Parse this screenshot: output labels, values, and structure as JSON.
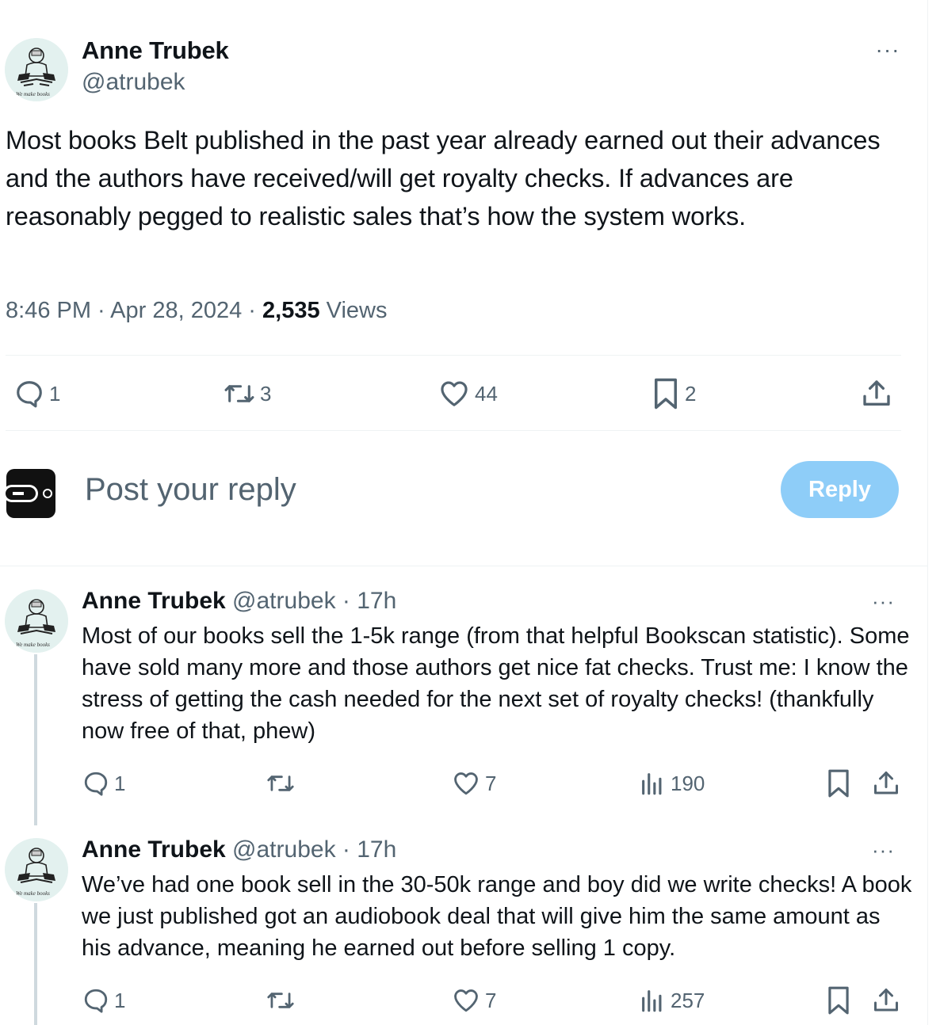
{
  "main_tweet": {
    "author_name": "Anne Trubek",
    "author_handle": "@atrubek",
    "avatar_caption": "We make books",
    "more_label": "···",
    "text": "Most books Belt published in the past year already earned out their advances and the authors have received/will get royalty checks. If advances are reasonably pegged to realistic sales that’s how the system works.",
    "time": "8:46 PM",
    "date": "Apr 28, 2024",
    "views_count": "2,535",
    "views_label": "Views",
    "separator": " · ",
    "actions": {
      "replies": "1",
      "reposts": "3",
      "likes": "44",
      "bookmarks": "2"
    }
  },
  "reply_composer": {
    "placeholder": "Post your reply",
    "button_label": "Reply"
  },
  "thread": [
    {
      "author_name": "Anne Trubek",
      "author_handle": "@atrubek",
      "time_ago": "17h",
      "avatar_caption": "We make books",
      "text": "Most of our books sell the 1-5k range (from that helpful Bookscan statistic). Some have sold many more and those authors get nice fat checks.  Trust me: I know the stress of getting the cash needed for the next set of royalty checks! (thankfully now free of that, phew)",
      "actions": {
        "replies": "1",
        "reposts": "",
        "likes": "7",
        "views": "190"
      }
    },
    {
      "author_name": "Anne Trubek",
      "author_handle": "@atrubek",
      "time_ago": "17h",
      "avatar_caption": "We make books",
      "text": "We’ve had one book sell in the 30-50k range and boy did we write checks! A book we just published got an audiobook deal that will give him the same amount as his advance, meaning he earned out before selling 1 copy.",
      "actions": {
        "replies": "1",
        "reposts": "",
        "likes": "7",
        "views": "257"
      }
    }
  ],
  "icons": {
    "reply": "speech-bubble-icon",
    "repost": "repost-arrows-icon",
    "like": "heart-icon",
    "bookmark": "bookmark-icon",
    "share": "share-upload-icon",
    "views": "bar-chart-icon",
    "more": "more-dots-icon"
  },
  "colors": {
    "text_primary": "#0f1419",
    "text_secondary": "#536471",
    "reply_button_disabled": "#8ecdf8",
    "divider": "#eff3f4",
    "thread_line": "#cfd9de"
  }
}
